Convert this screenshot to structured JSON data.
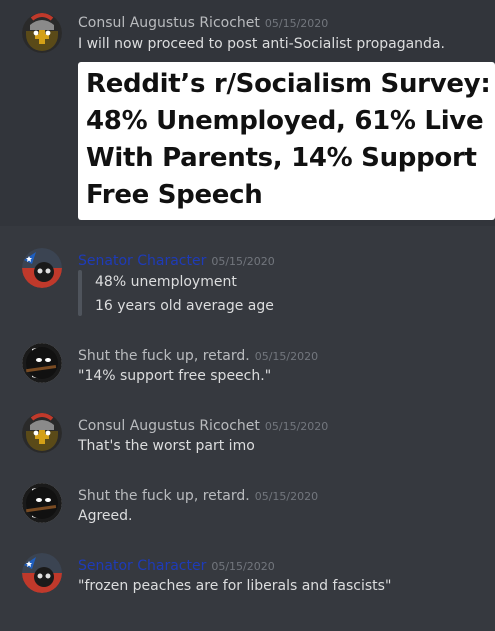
{
  "colors": {
    "background": "#36393f",
    "highlight": "#32353b",
    "text": "#dcddde",
    "timestamp": "#72767d",
    "consul_name": "#b9bbbe",
    "senator_name": "#1e3bb8",
    "shut_name": "#b9bbbe"
  },
  "messages": [
    {
      "author": "Consul Augustus Ricochet",
      "timestamp": "05/15/2020",
      "avatar_icon": "rome-countryball-avatar-icon",
      "text": "I will now proceed to post anti-Socialist propaganda.",
      "image_lines": [
        "Reddit’s r/Socialism Survey:",
        "48% Unemployed, 61% Live",
        "With Parents, 14% Support",
        "Free Speech"
      ]
    },
    {
      "author": "Senator Character",
      "timestamp": "05/15/2020",
      "avatar_icon": "senator-countryball-avatar-icon",
      "quote_lines": [
        "48% unemployment",
        "16 years old average age"
      ]
    },
    {
      "author": "Shut the fuck up, retard.",
      "timestamp": "05/15/2020",
      "avatar_icon": "musket-countryball-avatar-icon",
      "text": "\"14% support free speech.\""
    },
    {
      "author": "Consul Augustus Ricochet",
      "timestamp": "05/15/2020",
      "avatar_icon": "rome-countryball-avatar-icon",
      "text": "That's the worst part imo"
    },
    {
      "author": "Shut the fuck up, retard.",
      "timestamp": "05/15/2020",
      "avatar_icon": "musket-countryball-avatar-icon",
      "text": "Agreed."
    },
    {
      "author": "Senator Character",
      "timestamp": "05/15/2020",
      "avatar_icon": "senator-countryball-avatar-icon",
      "text": "\"frozen peaches are for liberals and fascists\""
    }
  ]
}
